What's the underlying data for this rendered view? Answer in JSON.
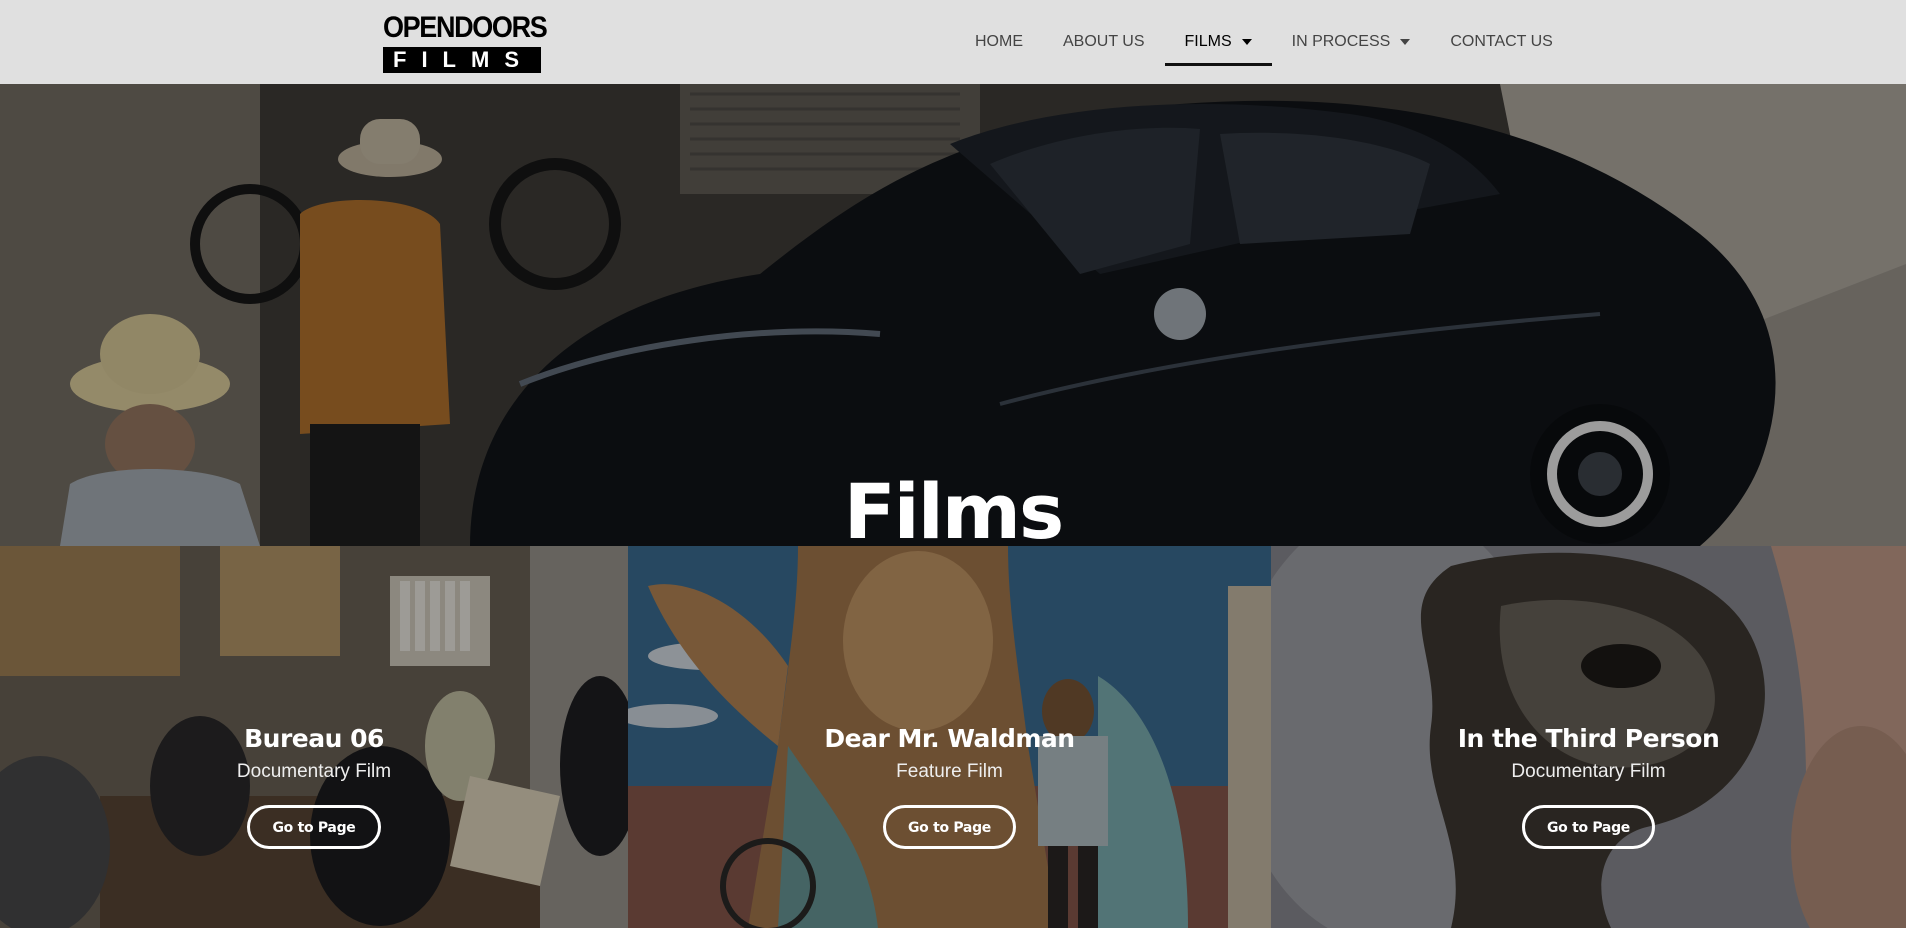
{
  "brand": {
    "logo_line1": "OPENDOORS",
    "logo_line2": "FILMS"
  },
  "nav": {
    "items": [
      {
        "label": "HOME"
      },
      {
        "label": "ABOUT US"
      },
      {
        "label": "FILMS",
        "active": true,
        "has_dropdown": true
      },
      {
        "label": "IN PROCESS",
        "has_dropdown": true
      },
      {
        "label": "CONTACT US"
      }
    ]
  },
  "hero": {
    "title": "Films"
  },
  "films": [
    {
      "title": "Bureau 06",
      "type": "Documentary Film",
      "button": "Go to Page"
    },
    {
      "title": "Dear Mr. Waldman",
      "type": "Feature Film",
      "button": "Go to Page"
    },
    {
      "title": "In the Third Person",
      "type": "Documentary Film",
      "button": "Go to Page"
    }
  ],
  "colors": {
    "header_bg": "#e0e0e0",
    "nav_text": "#444444",
    "nav_active": "#000000",
    "overlay_text": "#ffffff"
  }
}
